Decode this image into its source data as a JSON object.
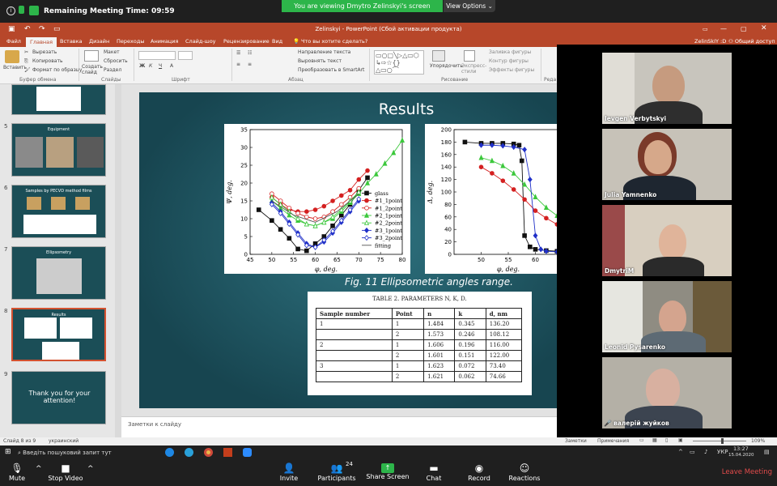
{
  "zoom_top": {
    "meeting_time_label": "Remaining Meeting Time: 09:59",
    "viewing_banner": "You are viewing Dmytro Zelinskyi's screen",
    "view_options": "View Options"
  },
  "ppt": {
    "title": "Zelinskyi - PowerPoint (Сбой активации продукта)",
    "user": "ZelinSkIY :D",
    "share": "Общий доступ",
    "tabs": [
      "Файл",
      "Главная",
      "Вставка",
      "Дизайн",
      "Переходы",
      "Анимация",
      "Слайд-шоу",
      "Рецензирование",
      "Вид"
    ],
    "tellme": "Что вы хотите сделать?",
    "ribbon": {
      "paste": "Вставить",
      "cut": "Вырезать",
      "copy": "Копировать",
      "format_painter": "Формат по образцу",
      "clipboard_group": "Буфер обмена",
      "new_slide": "Создать слайд",
      "layout": "Макет",
      "reset": "Сбросить",
      "section": "Раздел",
      "slides_group": "Слайды",
      "font_group": "Шрифт",
      "text_direction": "Направление текста",
      "align_text": "Выровнять текст",
      "smartart": "Преобразовать в SmartArt",
      "paragraph_group": "Абзац",
      "arrange": "Упорядочить",
      "quick_styles": "Экспресс-стили",
      "shape_fill": "Заливка фигуры",
      "shape_outline": "Контур фигуры",
      "shape_effects": "Эффекты фигуры",
      "drawing_group": "Рисование",
      "editing_group": "Реда"
    },
    "thumbs": [
      {
        "num": "5",
        "title": "Equipment"
      },
      {
        "num": "6",
        "title": "Samples by PECVD method films"
      },
      {
        "num": "7",
        "title": "Ellipsometry"
      },
      {
        "num": "8",
        "title": "Results"
      },
      {
        "num": "9",
        "title": "Thank you for your attention!"
      }
    ],
    "notes_placeholder": "Заметки к слайду",
    "status": {
      "slide_info": "Слайд 8 из 9",
      "language": "украинский",
      "notes": "Заметки",
      "comments": "Примечания",
      "zoom": "109%"
    }
  },
  "slide": {
    "title": "Results",
    "fig_caption": "Fig. 11 Ellipsometric angles range.",
    "table_caption": "TABLE 2. PARAMETERS N, K, D.",
    "table_headers": [
      "Sample number",
      "Point",
      "n",
      "k",
      "d, nm"
    ],
    "table_rows": [
      [
        "1",
        "1",
        "1.484",
        "0.345",
        "136.20"
      ],
      [
        "",
        "2",
        "1.573",
        "0.246",
        "108.12"
      ],
      [
        "2",
        "1",
        "1.606",
        "0.196",
        "116.00"
      ],
      [
        "",
        "2",
        "1.601",
        "0.151",
        "122.00"
      ],
      [
        "3",
        "1",
        "1.623",
        "0.072",
        "73.40"
      ],
      [
        "",
        "2",
        "1.621",
        "0.062",
        "74.66"
      ]
    ]
  },
  "chart_data": [
    {
      "type": "line",
      "xlabel": "φ, deg.",
      "ylabel": "Ψ, deg.",
      "xlim": [
        45,
        80
      ],
      "ylim": [
        0,
        35
      ],
      "xticks": [
        45,
        50,
        55,
        60,
        65,
        70,
        75,
        80
      ],
      "yticks": [
        0,
        5,
        10,
        15,
        20,
        25,
        30,
        35
      ],
      "legend_position": "right",
      "series": [
        {
          "name": "glass",
          "color": "#111111",
          "marker": "square",
          "x": [
            47,
            50,
            52,
            54,
            56,
            58,
            60,
            62,
            64,
            66,
            68,
            70,
            72
          ],
          "y": [
            12.5,
            9.5,
            7,
            4.5,
            1.5,
            1,
            3,
            5,
            8,
            11,
            14,
            18,
            21.5
          ]
        },
        {
          "name": "#1_1point",
          "color": "#d42020",
          "marker": "circle",
          "x": [
            50,
            52,
            54,
            56,
            58,
            60,
            62,
            64,
            66,
            68,
            70,
            72
          ],
          "y": [
            16,
            14,
            12.5,
            12,
            12,
            12.5,
            13.5,
            15,
            16.5,
            18,
            21,
            23.5
          ]
        },
        {
          "name": "#1_2point",
          "color": "#d42020",
          "marker": "circle-open",
          "x": [
            50,
            52,
            54,
            56,
            58,
            60,
            62,
            64,
            66,
            68,
            70
          ],
          "y": [
            17,
            15,
            13,
            11.5,
            10.5,
            10,
            10.5,
            12,
            14,
            16,
            18.5
          ]
        },
        {
          "name": "#2_1point",
          "color": "#3cc83c",
          "marker": "triangle",
          "x": [
            50,
            52,
            54,
            56,
            58,
            60,
            62,
            64,
            66,
            68,
            70,
            72,
            74,
            76,
            78,
            80
          ],
          "y": [
            15,
            13,
            11,
            9.5,
            8.5,
            8,
            9,
            10,
            12,
            14.5,
            17,
            20,
            22.5,
            25.5,
            28.5,
            32
          ]
        },
        {
          "name": "#2_2point",
          "color": "#3cc83c",
          "marker": "triangle-open",
          "x": [
            50,
            52,
            54,
            56,
            58,
            60,
            62,
            64,
            66,
            68,
            70
          ],
          "y": [
            16,
            14,
            12,
            10,
            8.5,
            8,
            9,
            10.5,
            12.5,
            15,
            17.5
          ]
        },
        {
          "name": "#3_1point",
          "color": "#2030c8",
          "marker": "diamond",
          "x": [
            50,
            52,
            54,
            56,
            58,
            60,
            62,
            64,
            66,
            68,
            70
          ],
          "y": [
            14.5,
            12,
            9,
            6,
            3,
            2,
            3.5,
            6,
            9,
            12,
            15
          ]
        },
        {
          "name": "#3_2point",
          "color": "#2030c8",
          "marker": "diamond-open",
          "x": [
            50,
            52,
            54,
            56,
            58,
            60,
            62,
            64,
            66,
            68,
            70
          ],
          "y": [
            14,
            11.5,
            8.5,
            5.5,
            2.5,
            2,
            4,
            6.5,
            9.5,
            12.5,
            15.5
          ]
        },
        {
          "name": "fitting",
          "color": "#555555",
          "marker": "none",
          "x": [
            50,
            55,
            60,
            65,
            70
          ],
          "y": [
            15,
            11,
            9,
            12,
            17
          ]
        }
      ]
    },
    {
      "type": "line",
      "xlabel": "φ, deg.",
      "ylabel": "Δ, deg.",
      "xlim": [
        45,
        65
      ],
      "ylim": [
        0,
        200
      ],
      "xticks": [
        50,
        55,
        60
      ],
      "yticks": [
        0,
        20,
        40,
        60,
        80,
        100,
        120,
        140,
        160,
        180,
        200
      ],
      "series": [
        {
          "color": "#111111",
          "marker": "square",
          "x": [
            47,
            50,
            52,
            54,
            56,
            57,
            57.5,
            58,
            59,
            60,
            62,
            64
          ],
          "y": [
            180,
            178,
            178,
            178,
            177,
            175,
            150,
            30,
            12,
            8,
            6,
            5
          ]
        },
        {
          "color": "#d42020",
          "marker": "circle",
          "x": [
            50,
            52,
            54,
            56,
            58,
            60,
            62,
            64
          ],
          "y": [
            140,
            130,
            118,
            104,
            88,
            70,
            58,
            48
          ]
        },
        {
          "color": "#3cc83c",
          "marker": "triangle",
          "x": [
            50,
            52,
            54,
            56,
            58,
            60,
            62,
            64
          ],
          "y": [
            155,
            150,
            142,
            130,
            112,
            92,
            75,
            62
          ]
        },
        {
          "color": "#2030c8",
          "marker": "diamond",
          "x": [
            50,
            52,
            54,
            56,
            58,
            59,
            60,
            61,
            62,
            64
          ],
          "y": [
            175,
            175,
            174,
            172,
            168,
            120,
            30,
            8,
            5,
            4
          ]
        }
      ]
    }
  ],
  "participants": [
    {
      "name": "Ievgen Verbytskyi"
    },
    {
      "name": "Julia Yamnenko"
    },
    {
      "name": "DmytriM"
    },
    {
      "name": "Leonid Pysarenko"
    },
    {
      "name": "валерій жуйков"
    }
  ],
  "taskbar": {
    "search": "Введіть пошуковий запит тут",
    "lang": "УКР",
    "time": "13:27",
    "date": "15.04.2020"
  },
  "zoom_bottom": {
    "mute": "Mute",
    "stop_video": "Stop Video",
    "invite": "Invite",
    "participants": "Participants",
    "participants_count": "24",
    "share_screen": "Share Screen",
    "chat": "Chat",
    "record": "Record",
    "reactions": "Reactions",
    "leave": "Leave Meeting"
  }
}
